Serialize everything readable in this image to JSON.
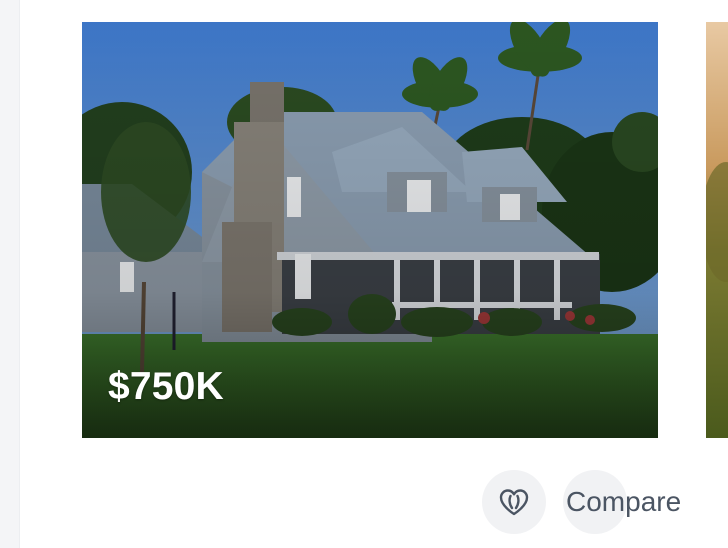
{
  "listing": {
    "price": "$750K",
    "image_icon": "house-photo",
    "favorite_icon": "heart-outline-icon",
    "compare_label": "Compare"
  },
  "colors": {
    "sky": "#4a7fc4",
    "lawn": "#3a6a2a",
    "overlay": "#000000",
    "button_bg": "#f1f2f4",
    "compare_text": "#4b5563",
    "price_text": "#ffffff"
  }
}
